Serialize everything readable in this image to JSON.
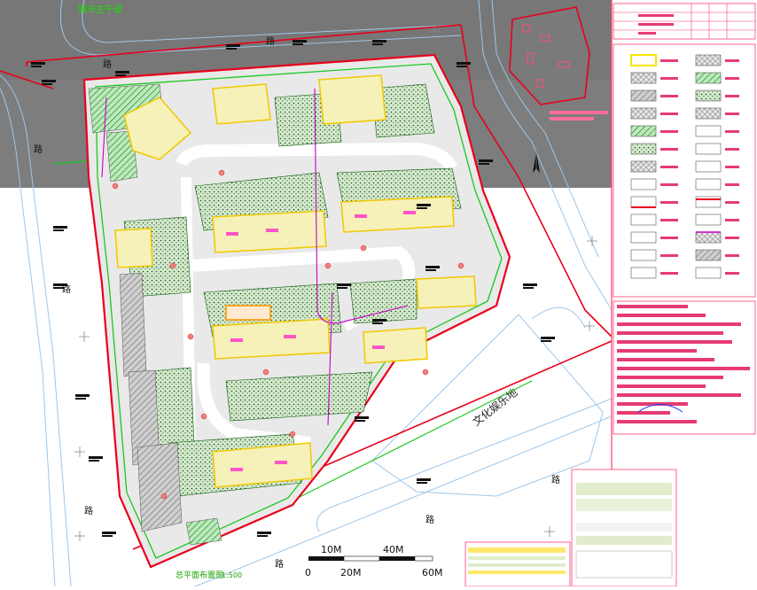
{
  "drawing": {
    "title_label": "总平面布置图",
    "title_scale": "1:500",
    "top_road_label": "城市主干道",
    "cultural_label": "文化娱乐地"
  },
  "scale_bar": {
    "labels_top": [
      "10M",
      "40M"
    ],
    "labels_bottom": [
      "0",
      "20M",
      "60M"
    ]
  },
  "road_markers": [
    "路",
    "路",
    "路",
    "路",
    "路",
    "路",
    "路",
    "路"
  ],
  "colors": {
    "plot_red": "#e8001c",
    "building_yellow": "#f2e600",
    "green_line": "#19c81e",
    "magenta_line": "#c800c8",
    "dark_road": "#4a4a4a",
    "legend_pink": "#e63b73",
    "hatch_green": "#0a6e0a"
  }
}
